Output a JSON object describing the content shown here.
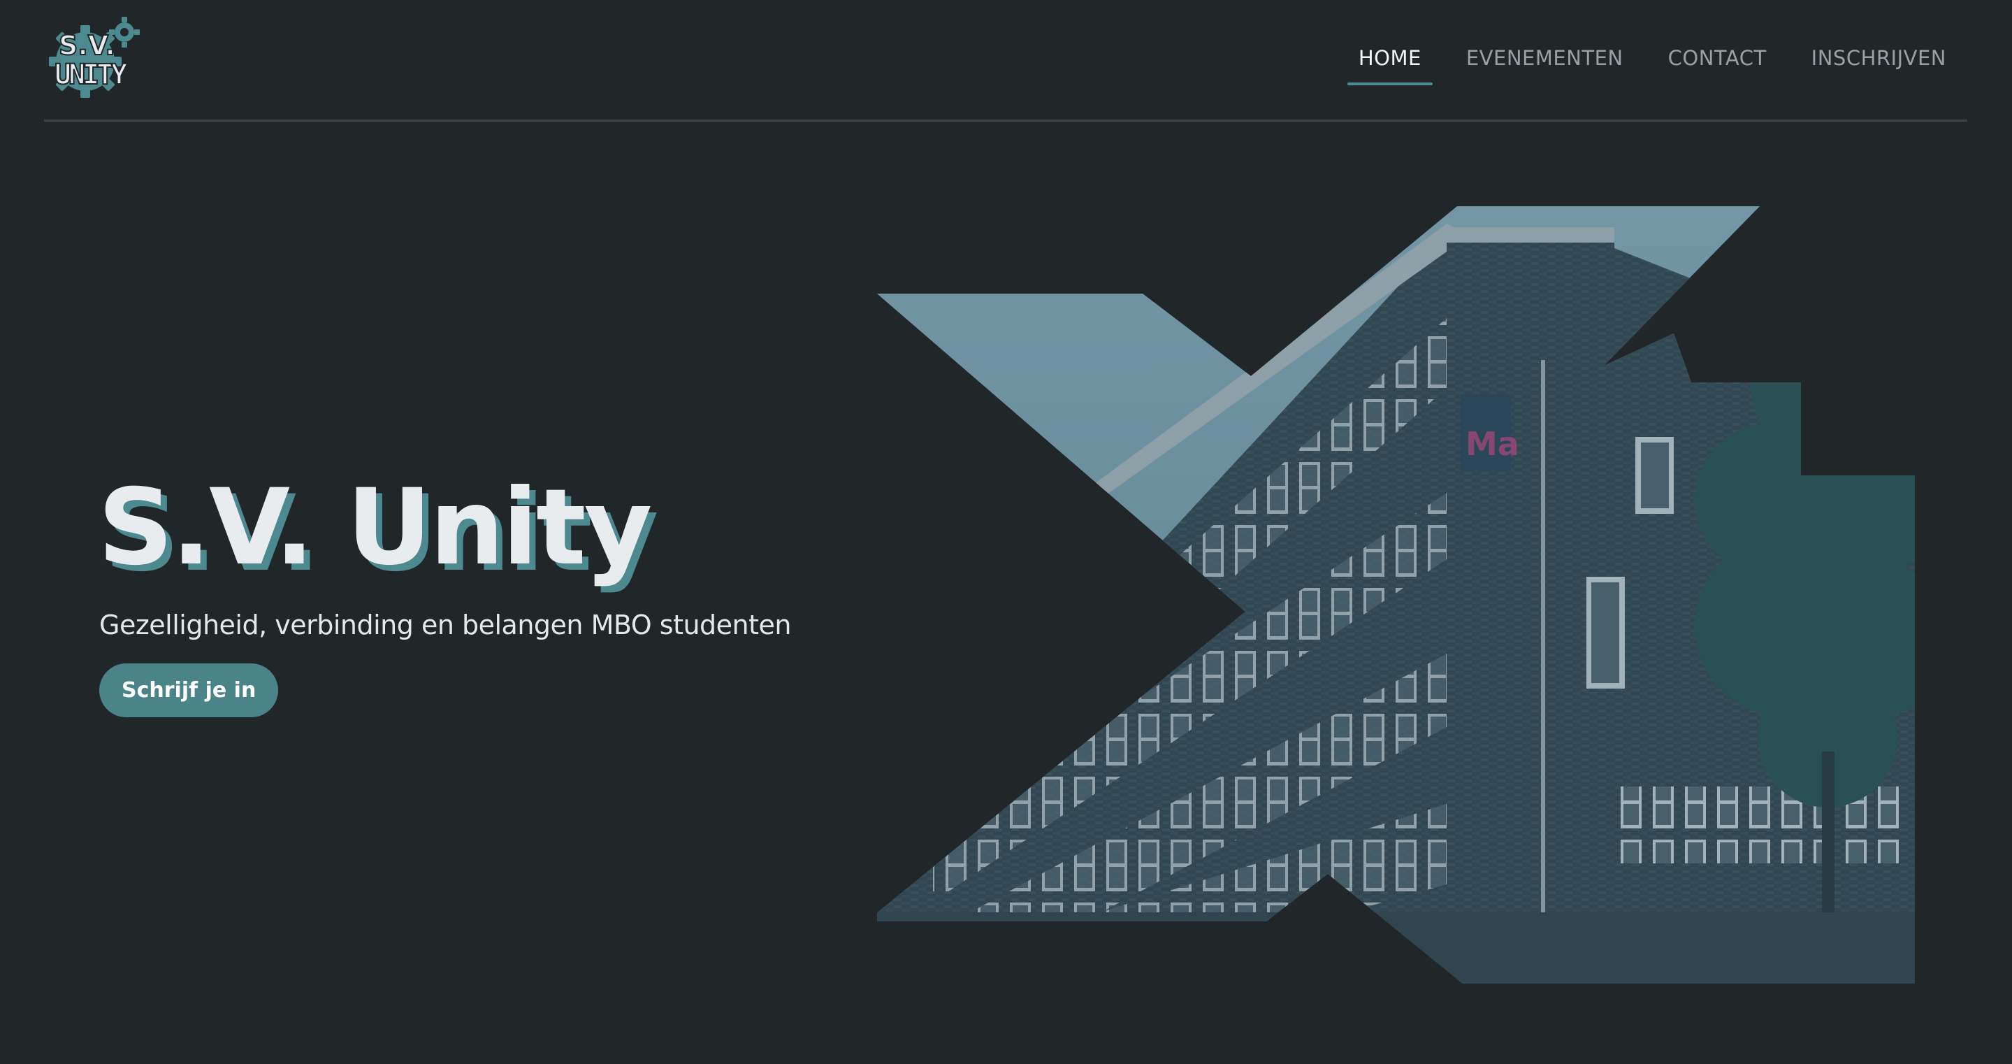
{
  "brand": {
    "logo_text_top": "S.V.",
    "logo_text_bottom": "UNITY",
    "colors": {
      "background": "#212629",
      "accent": "#4c8a8f",
      "text": "#e9ecee",
      "nav_inactive": "#9aa1a5"
    }
  },
  "nav": {
    "items": [
      {
        "label": "HOME",
        "active": true
      },
      {
        "label": "EVENEMENTEN",
        "active": false
      },
      {
        "label": "CONTACT",
        "active": false
      },
      {
        "label": "INSCHRIJVEN",
        "active": false
      }
    ]
  },
  "hero": {
    "title": "S.V. Unity",
    "subtitle": "Gezelligheid, verbinding en belangen MBO studenten",
    "cta_label": "Schrijf je in",
    "image_sign_text": "Ma"
  },
  "icons": {
    "logo": "gear-logo-icon"
  }
}
